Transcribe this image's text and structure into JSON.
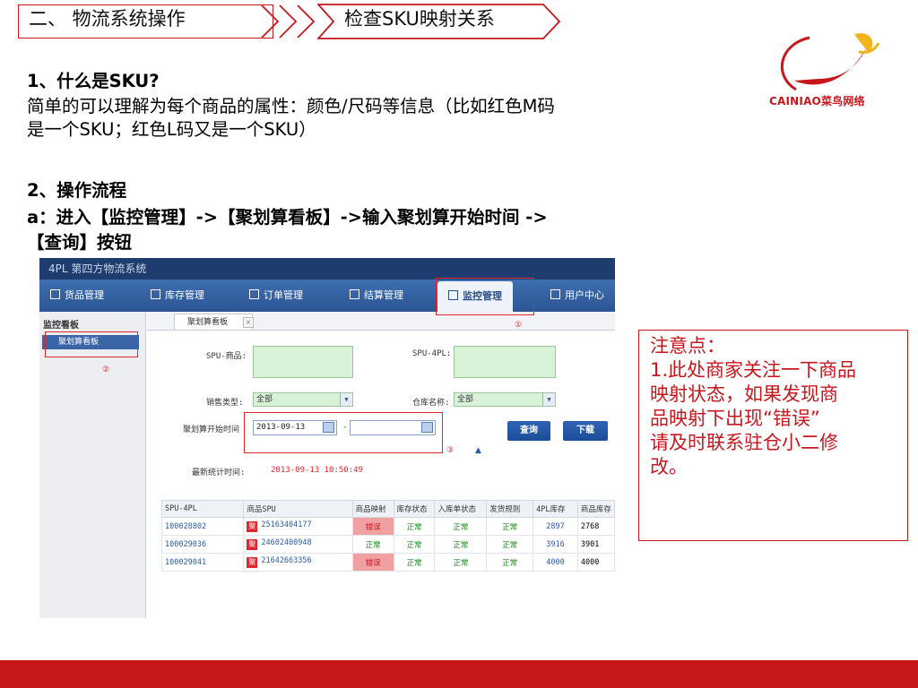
{
  "header": {
    "section_label": "二、 物流系统操作",
    "topic_label": "检查SKU映射关系"
  },
  "logo": {
    "text": "CAINIAO菜鸟网络"
  },
  "content": {
    "q1_title": "1、什么是SKU?",
    "q1_line1": "简单的可以理解为每个商品的属性：颜色/尺码等信息（比如红色M码",
    "q1_line2": "是一个SKU；红色L码又是一个SKU）",
    "q2_title": "2、操作流程",
    "q2_line1": "a：进入【监控管理】->【聚划算看板】->输入聚划算开始时间 ->",
    "q2_line2": "【查询】按钮"
  },
  "note": {
    "line1": "注意点：",
    "line2": "1.此处商家关注一下商品",
    "line3": "映射状态，如果发现商",
    "line4": "品映射下出现“错误”",
    "line5": "请及时联系驻仓小二修",
    "line6": "改。"
  },
  "screenshot": {
    "app_title": "4PL 第四方物流系统",
    "nav": [
      {
        "label": "货品管理",
        "icon": "grid-icon"
      },
      {
        "label": "库存管理",
        "icon": "box-icon"
      },
      {
        "label": "订单管理",
        "icon": "list-icon"
      },
      {
        "label": "结算管理",
        "icon": "settle-icon"
      },
      {
        "label": "监控管理",
        "icon": "monitor-icon"
      },
      {
        "label": "用户中心",
        "icon": "user-icon"
      }
    ],
    "sidebar": {
      "header": "监控看板",
      "item": "聚划算看板"
    },
    "tab": "聚划算看板",
    "form": {
      "spu_goods_label": "SPU-商品:",
      "spu_4pl_label": "SPU-4PL:",
      "sales_type_label": "销售类型:",
      "sales_type_value": "全部",
      "warehouse_label": "仓库名称:",
      "warehouse_value": "全部",
      "start_time_label": "聚划算开始时间",
      "start_time_value": "2013-09-13",
      "dash": "-",
      "query_button": "查询",
      "download_button": "下载",
      "stat_time_label": "最新统计时间:",
      "stat_time_value": "2013-09-13 10:50:49"
    },
    "markers": {
      "m1": "①",
      "m2": "②",
      "m3": "③"
    },
    "table": {
      "headers": [
        "SPU-4PL",
        "商品SPU",
        "商品映射",
        "库存状态",
        "入库单状态",
        "发货规则",
        "4PL库存",
        "商品库存"
      ],
      "ju_label": "聚",
      "rows": [
        [
          "100028802",
          "25163404177",
          "错误",
          "正常",
          "正常",
          "正常",
          "2897",
          "2768"
        ],
        [
          "100029036",
          "24602400948",
          "正常",
          "正常",
          "正常",
          "正常",
          "3916",
          "3901"
        ],
        [
          "100029041",
          "21642663356",
          "错误",
          "正常",
          "正常",
          "正常",
          "4000",
          "4000"
        ]
      ]
    }
  },
  "colors": {
    "brand_red": "#c8161d",
    "nav_blue": "#2c5592",
    "ok_green": "#1d8a1d",
    "error_red": "#e0262a"
  }
}
